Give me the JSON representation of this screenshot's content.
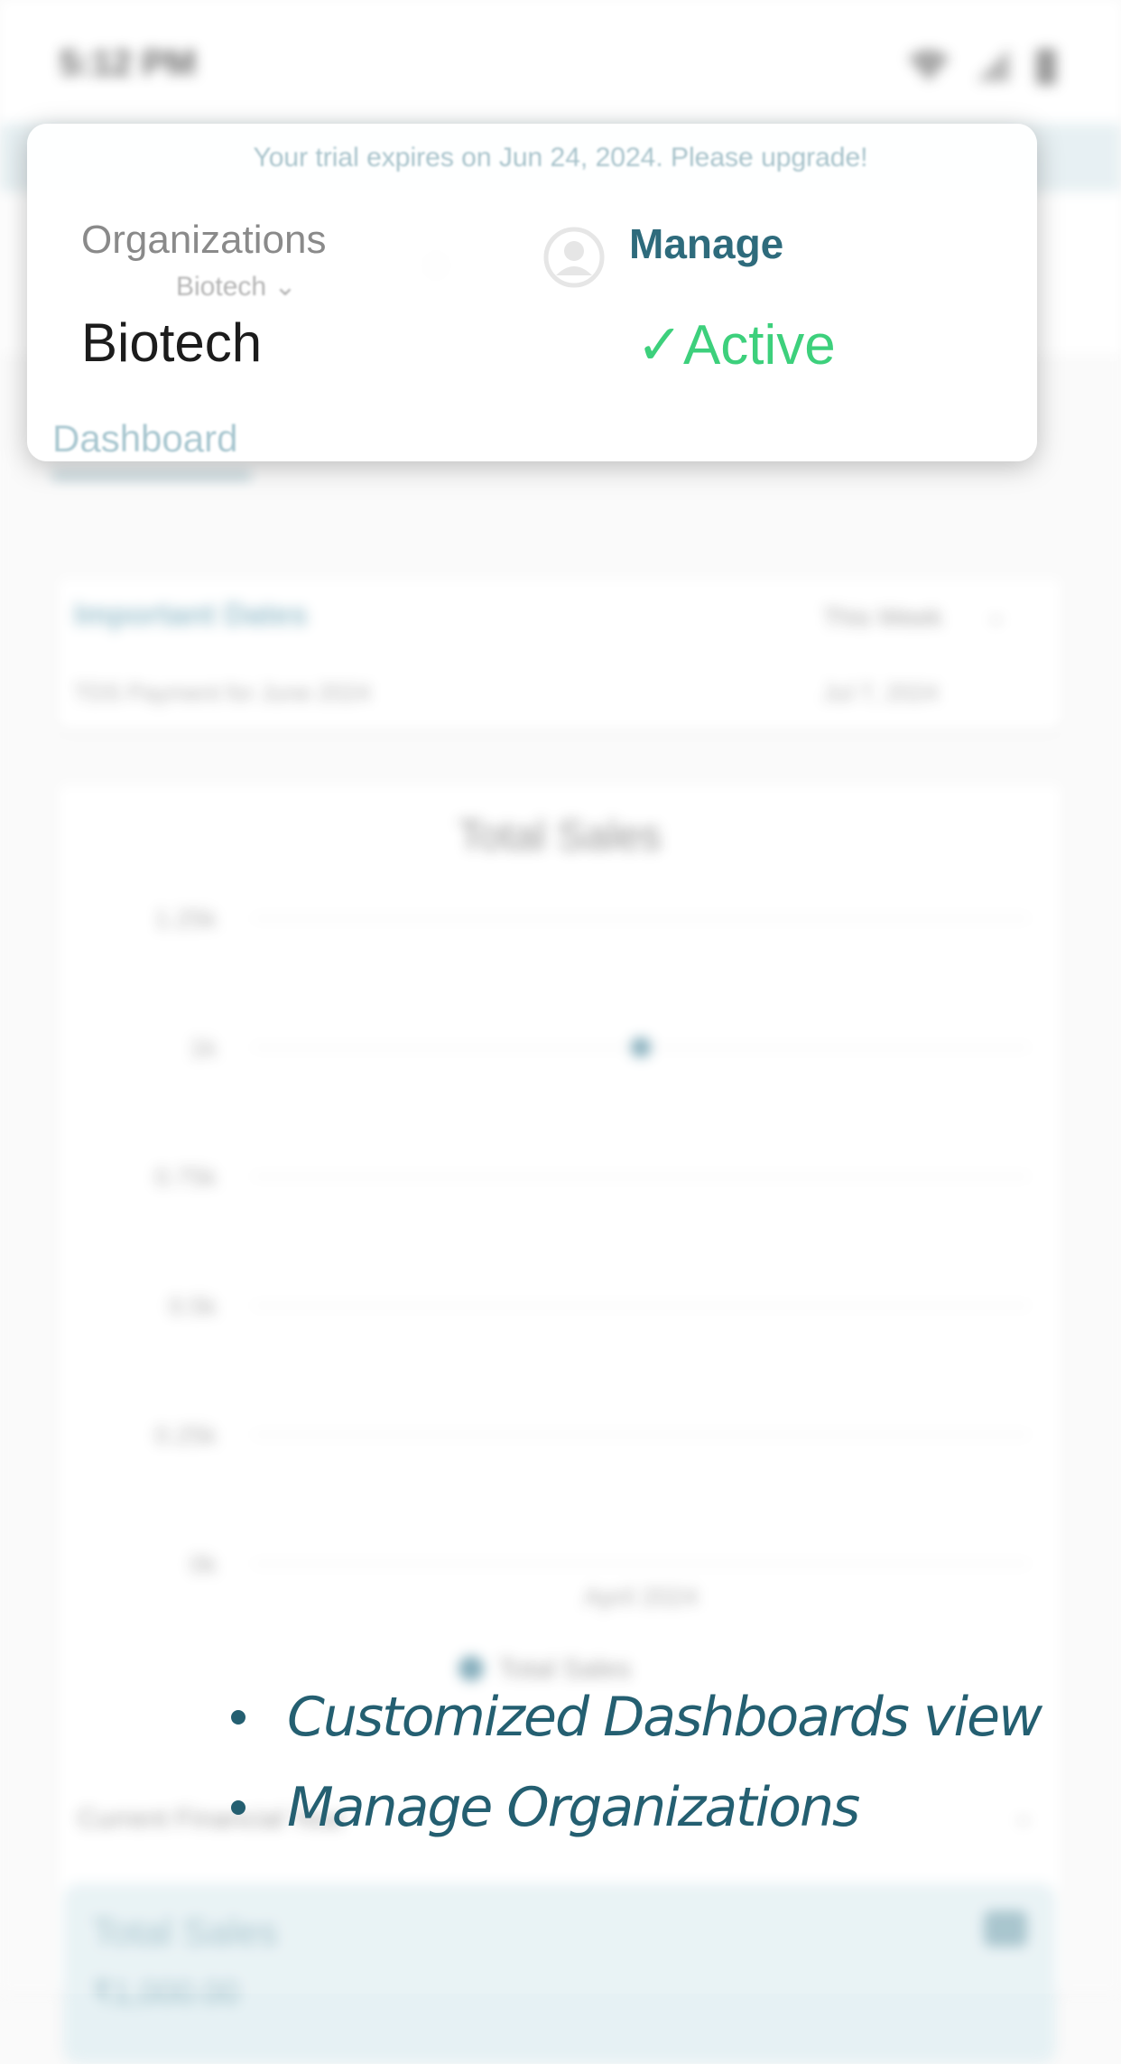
{
  "status_bar": {
    "time": "5:12 PM",
    "icons": [
      "wifi-icon",
      "signal-icon",
      "battery-icon"
    ]
  },
  "banner": {
    "text": "Your trial expires on Jun 24, 2024. Please upgrade!"
  },
  "header": {
    "org_selector": "Biotech",
    "icons": [
      "menu-icon",
      "gear-icon",
      "avatar-icon"
    ]
  },
  "tabs": [
    {
      "label": "Dashboard",
      "active": true
    }
  ],
  "important_dates": {
    "title": "Important Dates",
    "filter": "This Week",
    "rows": [
      {
        "label": "TDS Payment for June 2024",
        "date": "Jul 7, 2024"
      }
    ]
  },
  "chart_data": {
    "type": "line",
    "title": "Total Sales",
    "categories": [
      "April 2024"
    ],
    "series": [
      {
        "name": "Total Sales",
        "values": [
          1000
        ]
      }
    ],
    "yticks": [
      "1.25k",
      "1k",
      "0.75k",
      "0.5k",
      "0.25k",
      "0k"
    ],
    "ylim": [
      0,
      1250
    ],
    "grid": true,
    "legend": "bottom",
    "color": "#6f9fb0"
  },
  "financial_year": {
    "selected": "Current Financial Year"
  },
  "total_sales_card": {
    "title": "Total Sales",
    "value": "₹1,000.00"
  },
  "popup": {
    "heading": "Organizations",
    "manage_label": "Manage",
    "org_name": "Biotech",
    "status": "Active",
    "status_icon": "check-icon",
    "status_color": "#3dd07c",
    "accent": "#2e6b7c"
  },
  "features": [
    "Customized Dashboards view",
    "Manage Organizations"
  ]
}
